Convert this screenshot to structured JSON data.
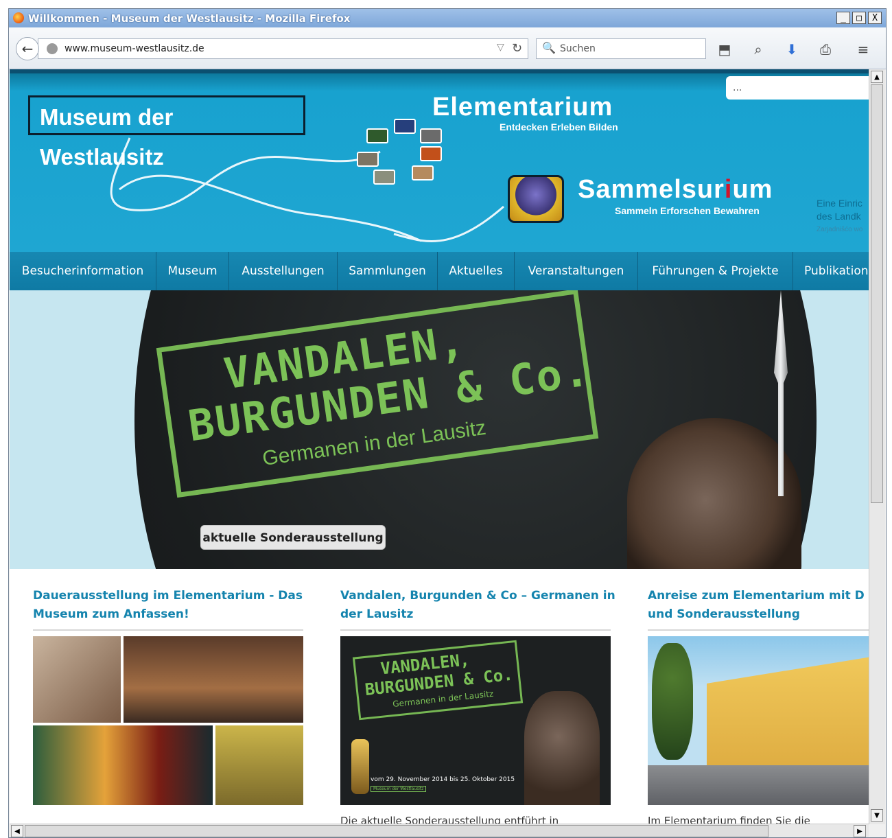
{
  "window": {
    "title": "Willkommen - Museum der Westlausitz - Mozilla Firefox",
    "controls": [
      "_",
      "□",
      "X"
    ]
  },
  "toolbar": {
    "back_icon": "back-arrow-icon",
    "url": "www.museum-westlausitz.de",
    "search_placeholder": "Suchen",
    "icons": [
      "pocket-icon",
      "search-icon",
      "download-icon",
      "print-icon",
      "menu-icon"
    ]
  },
  "header": {
    "site_search_value": "...",
    "logo": "Museum der Westlausitz",
    "elementarium": {
      "title": "Elementarium",
      "subtitle": "Entdecken Erleben Bilden"
    },
    "sammelsurium": {
      "title_part1": "Sammelsur",
      "title_red": "i",
      "title_part2": "um",
      "subtitle": "Sammeln Erforschen Bewahren"
    },
    "side_note": {
      "line1": "Eine Einric",
      "line2": "des Landk",
      "line3": "Zarjadnišćo wo"
    }
  },
  "nav": {
    "items": [
      "Besucherinformation",
      "Museum",
      "Ausstellungen",
      "Sammlungen",
      "Aktuelles",
      "Veranstaltungen",
      "Führungen & Projekte",
      "Publikation"
    ]
  },
  "hero": {
    "line1": "VANDALEN,",
    "line2": "BURGUNDEN & Co.",
    "line3": "Germanen in der Lausitz",
    "button": "aktuelle Sonderausstellung"
  },
  "teasers": [
    {
      "title": "Dauerausstellung im Elementarium - Das Museum zum Anfassen!",
      "excerpt": ""
    },
    {
      "title": "Vandalen, Burgunden & Co – Germanen in der Lausitz",
      "poster_line1": "VANDALEN,",
      "poster_line2": "BURGUNDEN & Co.",
      "poster_line3": "Germanen in der Lausitz",
      "poster_dates": "vom 29. November 2014 bis 25. Oktober 2015",
      "poster_org": "Museum der Westlausitz",
      "excerpt": "Die aktuelle Sonderausstellung entführt in"
    },
    {
      "title": "Anreise zum Elementarium mit D und Sonderausstellung",
      "excerpt": "Im Elementarium finden Sie die"
    }
  ],
  "colors": {
    "brand_blue": "#1fa6d2",
    "nav_blue": "#1384ae",
    "accent_green": "#7cc257",
    "teaser_title": "#1584ae"
  }
}
